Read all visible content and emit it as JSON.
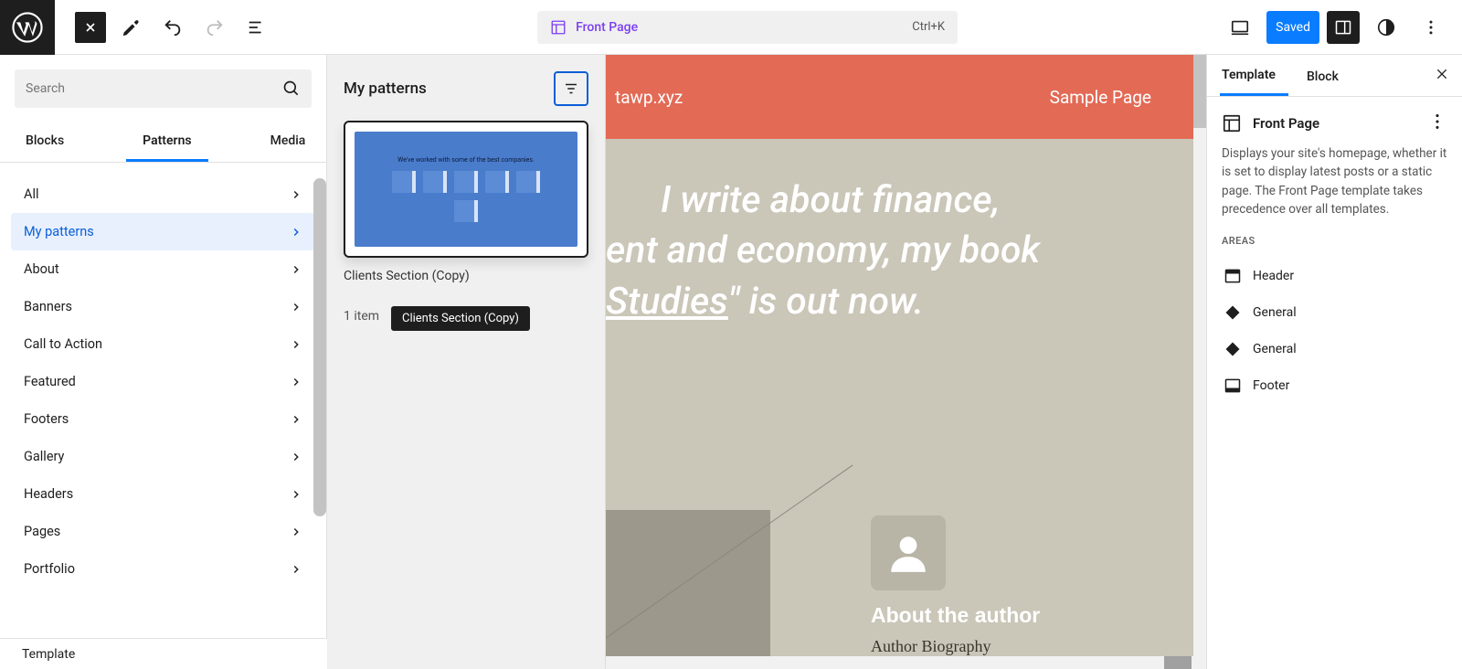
{
  "topbar": {
    "document_title": "Front Page",
    "shortcut": "Ctrl+K",
    "saved_label": "Saved"
  },
  "inserter": {
    "search_placeholder": "Search",
    "tabs": [
      "Blocks",
      "Patterns",
      "Media"
    ],
    "active_tab": 1,
    "categories": [
      {
        "label": "All"
      },
      {
        "label": "My patterns"
      },
      {
        "label": "About"
      },
      {
        "label": "Banners"
      },
      {
        "label": "Call to Action"
      },
      {
        "label": "Featured"
      },
      {
        "label": "Footers"
      },
      {
        "label": "Gallery"
      },
      {
        "label": "Headers"
      },
      {
        "label": "Pages"
      },
      {
        "label": "Portfolio"
      }
    ],
    "active_category": 1,
    "status_line": "Template"
  },
  "flyout": {
    "title": "My patterns",
    "pattern_preview_text": "We've worked with some of the best companies.",
    "pattern_label": "Clients Section (Copy)",
    "tooltip": "Clients Section (Copy)",
    "count_label": "1 item"
  },
  "canvas": {
    "site_url": "tawp.xyz",
    "nav_item": "Sample Page",
    "hero_line1_lead": "I write about finance,",
    "hero_line2_lead": "ent and economy, my book",
    "hero_book": "Studies",
    "hero_line3_tail": "\" is out now.",
    "about_heading": "About the author",
    "about_sub": "Author Biography"
  },
  "sidebar": {
    "tabs": [
      "Template",
      "Block"
    ],
    "active_tab": 0,
    "template_name": "Front Page",
    "description": "Displays your site's homepage, whether it is set to display latest posts or a static page. The Front Page template takes precedence over all templates.",
    "areas_label": "AREAS",
    "areas": [
      {
        "name": "Header",
        "icon": "header"
      },
      {
        "name": "General",
        "icon": "diamond"
      },
      {
        "name": "General",
        "icon": "diamond"
      },
      {
        "name": "Footer",
        "icon": "footer"
      }
    ]
  }
}
